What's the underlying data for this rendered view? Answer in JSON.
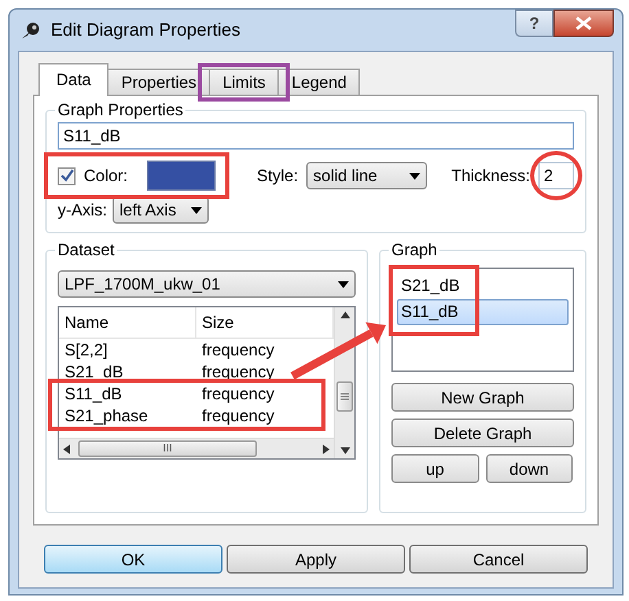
{
  "window": {
    "title": "Edit Diagram Properties",
    "help_label": "?"
  },
  "tabs": [
    {
      "label": "Data",
      "selected": true,
      "highlighted": false
    },
    {
      "label": "Properties",
      "selected": false,
      "highlighted": false
    },
    {
      "label": "Limits",
      "selected": false,
      "highlighted": true
    },
    {
      "label": "Legend",
      "selected": false,
      "highlighted": false
    }
  ],
  "graph_properties": {
    "title": "Graph Properties",
    "name_value": "S11_dB",
    "color": {
      "label": "Color:",
      "checked": true,
      "color": "#3550a3",
      "highlighted": true
    },
    "style": {
      "label": "Style:",
      "value": "solid line"
    },
    "thickness": {
      "label": "Thickness:",
      "value": "2",
      "circled": true
    },
    "y_axis": {
      "label": "y-Axis:",
      "value": "left Axis"
    }
  },
  "dataset": {
    "title": "Dataset",
    "selector": "LPF_1700M_ukw_01",
    "columns": [
      "Name",
      "Size"
    ],
    "rows": [
      {
        "name": "S[2,2]",
        "size": "frequency",
        "highlighted": false
      },
      {
        "name": "S21_dB",
        "size": "frequency",
        "highlighted": false
      },
      {
        "name": "S11_dB",
        "size": "frequency",
        "highlighted": true
      },
      {
        "name": "S21_phase",
        "size": "frequency",
        "highlighted": true
      }
    ],
    "scrollbar_label": "III"
  },
  "graph": {
    "title": "Graph",
    "highlighted": true,
    "items": [
      {
        "label": "S21_dB",
        "selected": false
      },
      {
        "label": "S11_dB",
        "selected": true
      }
    ],
    "buttons": [
      {
        "label": "New Graph",
        "kind": "wide"
      },
      {
        "label": "Delete Graph",
        "kind": "wide"
      },
      {
        "label": "up",
        "kind": "half"
      },
      {
        "label": "down",
        "kind": "half"
      }
    ]
  },
  "link_arrow": true,
  "footer_buttons": [
    {
      "label": "OK",
      "default": true
    },
    {
      "label": "Apply",
      "default": false
    },
    {
      "label": "Cancel",
      "default": false
    }
  ]
}
